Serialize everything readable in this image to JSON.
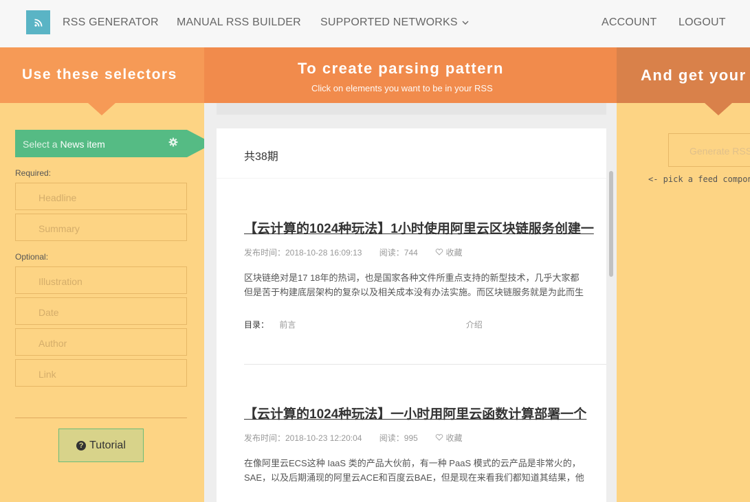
{
  "nav": {
    "rss_generator": "RSS GENERATOR",
    "manual_builder": "MANUAL RSS BUILDER",
    "supported_networks": "SUPPORTED NETWORKS",
    "account": "ACCOUNT",
    "logout": "LOGOUT"
  },
  "banners": {
    "left_title": "Use these selectors",
    "mid_title": "To create parsing pattern",
    "mid_subtitle": "Click on elements you want to be in your RSS",
    "right_title": "And get your"
  },
  "selectors": {
    "select_prefix": "Select a ",
    "select_item": "News item",
    "required_label": "Required:",
    "required": [
      "Headline",
      "Summary"
    ],
    "optional_label": "Optional:",
    "optional": [
      "Illustration",
      "Date",
      "Author",
      "Link"
    ],
    "tutorial": "Tutorial"
  },
  "content": {
    "count": "共38期",
    "articles": [
      {
        "title": "【云计算的1024种玩法】1小时使用阿里云区块链服务创建一",
        "date": "发布时间：2018-10-28 16:09:13",
        "reads": "阅读：744",
        "favorite": "收藏",
        "body1": "区块链绝对是17 18年的热词，也是国家各种文件所重点支持的新型技术，几乎大家都",
        "body2": "但是苦于构建底层架构的复杂以及相关成本没有办法实施。而区块链服务就是为此而生",
        "toc_label": "目录：",
        "toc_1": "前言",
        "toc_2": "介绍"
      },
      {
        "title": "【云计算的1024种玩法】一小时用阿里云函数计算部署一个",
        "date": "发布时间：2018-10-23 12:20:04",
        "reads": "阅读：995",
        "favorite": "收藏",
        "body1": "在像阿里云ECS这种 IaaS 类的产品大伙前，有一种 PaaS 模式的云产品是非常火的，",
        "body2": "SAE，以及后期涌现的阿里云ACE和百度云BAE，但是现在来看我们都知道其结果，他"
      }
    ]
  },
  "right": {
    "generate": "Generate RSS",
    "pick": "<- pick a feed component"
  },
  "colors": {
    "accent_teal": "#5ab4c5",
    "selector_green": "#55bb84",
    "panel_yellow": "#fdd484",
    "banner_orange": "#f18b4c"
  }
}
